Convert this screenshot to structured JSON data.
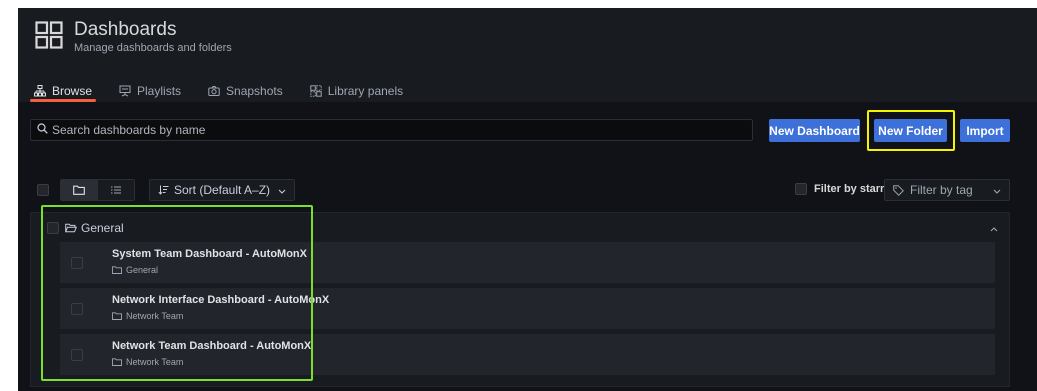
{
  "header": {
    "title": "Dashboards",
    "subtitle": "Manage dashboards and folders",
    "icon": "apps-grid-icon"
  },
  "tabs": [
    {
      "label": "Browse",
      "icon": "sitemap-icon",
      "active": true
    },
    {
      "label": "Playlists",
      "icon": "presentation-icon",
      "active": false
    },
    {
      "label": "Snapshots",
      "icon": "camera-icon",
      "active": false
    },
    {
      "label": "Library panels",
      "icon": "library-panel-icon",
      "active": false
    }
  ],
  "search": {
    "placeholder": "Search dashboards by name",
    "value": ""
  },
  "actions": {
    "new_dashboard": "New Dashboard",
    "new_folder": "New Folder",
    "import": "Import"
  },
  "toolbar": {
    "sort_label": "Sort (Default A–Z)",
    "filter_starred_label": "Filter by starred",
    "filter_tag_placeholder": "Filter by tag"
  },
  "folder": {
    "name": "General",
    "dashboards": [
      {
        "title": "System Team Dashboard - AutoMonX",
        "folder": "General"
      },
      {
        "title": "Network Interface Dashboard - AutoMonX",
        "folder": "Network Team"
      },
      {
        "title": "Network Team Dashboard - AutoMonX",
        "folder": "Network Team"
      }
    ]
  },
  "colors": {
    "background": "#111217",
    "panel": "#181b1f",
    "row": "#22252b",
    "primary_button": "#3d71d9",
    "active_tab_underline": "#f55f3e",
    "annotation_yellow": "#f5f500",
    "annotation_green": "#7ae02c"
  }
}
